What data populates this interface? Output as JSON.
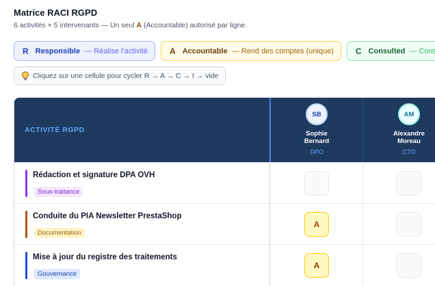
{
  "header": {
    "title": "Matrice RACI RGPD",
    "subtitle_before": "6 activités × 5 intervenants — Un seul ",
    "subtitle_highlight": "A",
    "subtitle_after": " (Accountable) autorisé par ligne."
  },
  "legend": [
    {
      "code": "R",
      "name": "Responsible",
      "desc": "— Réalise l’activité"
    },
    {
      "code": "A",
      "name": "Accountable",
      "desc": "— Rend des comptes (unique)"
    },
    {
      "code": "C",
      "name": "Consulted",
      "desc": "— Consulté"
    }
  ],
  "hint": {
    "icon": "lightbulb-icon",
    "text": "Cliquez sur une cellule pour cycler R → A → C → I → vide"
  },
  "table": {
    "activity_header": "ACTIVITÉ RGPD",
    "people": [
      {
        "initials": "SB",
        "name_line1": "Sophie",
        "name_line2": "Bernard",
        "role": "DPO"
      },
      {
        "initials": "AM",
        "name_line1": "Alexandre",
        "name_line2": "Moreau",
        "role": "CTO"
      }
    ],
    "rows": [
      {
        "title": "Rédaction et signature DPA OVH",
        "tag": "Sous-traitance",
        "bar_color": "#9333ea",
        "tag_bg": "#f3e8ff",
        "tag_color": "#7e22ce",
        "cells": [
          "·",
          "·"
        ]
      },
      {
        "title": "Conduite du PIA Newsletter PrestaShop",
        "tag": "Documentation",
        "bar_color": "#b45309",
        "tag_bg": "#fef3c7",
        "tag_color": "#a16207",
        "cells": [
          "A",
          "·"
        ]
      },
      {
        "title": "Mise à jour du registre des traitements",
        "tag": "Gouvernance",
        "bar_color": "#1d4ed8",
        "tag_bg": "#dbeafe",
        "tag_color": "#1e40af",
        "cells": [
          "A",
          "·"
        ]
      }
    ]
  },
  "colors": {
    "header_bg": "#1e3a5f",
    "accountable": "#facc15",
    "responsible": "#6366f1",
    "consulted": "#22c55e"
  }
}
